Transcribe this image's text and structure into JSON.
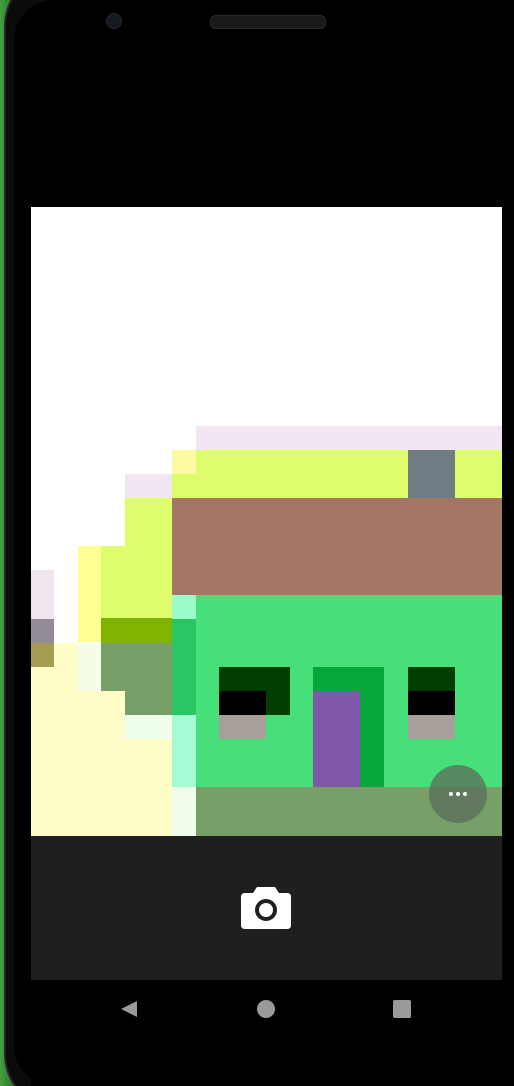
{
  "app": {
    "screen": "camera-viewfinder"
  },
  "colors": {
    "sky": "#ffffff",
    "roof_top": "#f1e6f1",
    "roof_yellow": "#ddfd6c",
    "chimney": "#6f7c83",
    "roof_brown": "#a47665",
    "wall_green": "#47df79",
    "wall_dark_green": "#2ac663",
    "door": "#7f58a9",
    "door_frame": "#07a63b",
    "window_dark": "#023e02",
    "window_black": "#000000",
    "window_sill": "#a99f9a",
    "ground": "#789f67",
    "light_green": "#9bfdc7",
    "left_yellow": "#fffec8",
    "controls_bg": "#1f1f1f"
  },
  "icons": {
    "more": "more-horiz-icon",
    "shutter": "camera-icon",
    "back": "nav-back-icon",
    "home": "nav-home-icon",
    "recent": "nav-recent-icon"
  }
}
